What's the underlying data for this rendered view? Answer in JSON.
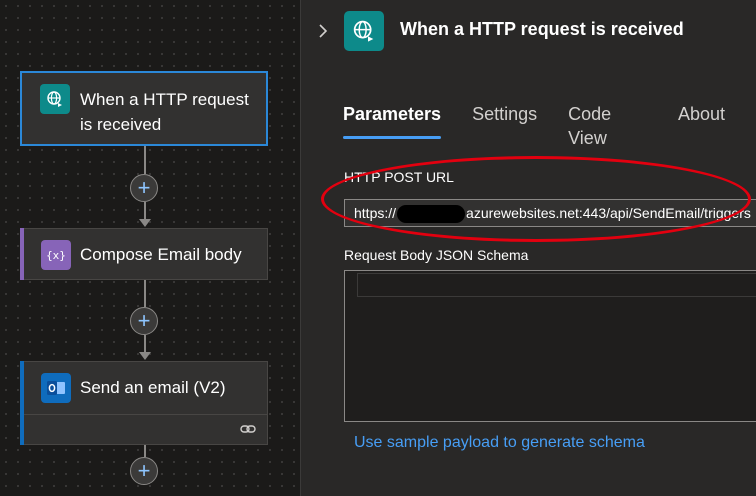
{
  "canvas": {
    "trigger_card": {
      "title": "When a HTTP request is received",
      "icon": "http-request-globe-icon"
    },
    "compose_card": {
      "title": "Compose Email body",
      "icon": "data-operation-curly-braces-icon"
    },
    "email_card": {
      "title": "Send an email (V2)",
      "icon": "outlook-icon"
    },
    "plus_label": "+"
  },
  "panel": {
    "title": "When a HTTP request is received",
    "collapse_icon": "chevron-right-icon",
    "tabs": [
      {
        "label": "Parameters",
        "active": true
      },
      {
        "label": "Settings",
        "active": false
      },
      {
        "label": "Code View",
        "active": false
      },
      {
        "label": "About",
        "active": false
      }
    ],
    "url_label": "HTTP POST URL",
    "url_prefix": "https://",
    "url_suffix": "azurewebsites.net:443/api/SendEmail/triggers",
    "schema_label": "Request Body JSON Schema",
    "schema_value": "",
    "sample_link": "Use sample payload to generate schema"
  },
  "colors": {
    "accent_blue": "#479ef5",
    "trigger_teal": "#0d8a8a",
    "compose_purple": "#8764b8",
    "outlook_blue": "#0f6cbd",
    "highlight_red": "#e3000f"
  }
}
